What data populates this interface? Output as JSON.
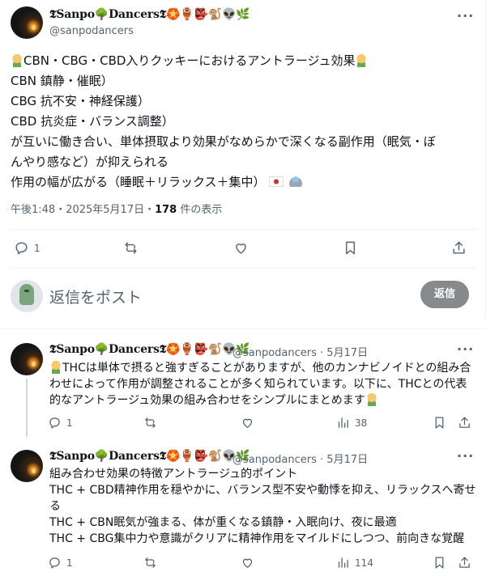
{
  "main_post": {
    "display_name": "𝕿𝐒𝐚𝐧𝐩𝐨🌳𝐃𝐚𝐧𝐜𝐞𝐫𝐬𝕿🏵️🏺👺🐒👽🌿",
    "handle": "@sanpodancers",
    "more_label": "···",
    "lines": [
      "CBN・CBG・CBD入りクッキーにおけるアントラージュ効果",
      "CBN 鎮静・催眠）",
      "CBG 抗不安・神経保護）",
      "CBD 抗炎症・バランス調整）",
      "が互いに働き合い、単体摂取より効果がなめらかで深くなる副作用（眠気・ぼ",
      "んやり感など）が抑えられる",
      "作用の幅が広がる（睡眠＋リラックス＋集中）"
    ],
    "timestamp_prefix": "午後1:48・2025年5月17日・",
    "view_count": "178",
    "view_suffix": " 件の表示",
    "reply_count": "1",
    "icons": [
      "reply-icon",
      "retweet-icon",
      "like-icon",
      "bookmark-icon",
      "share-icon"
    ]
  },
  "composer": {
    "placeholder": "返信をポスト",
    "button_label": "返信"
  },
  "replies": [
    {
      "display_name": "𝕿𝐒𝐚𝐧𝐩𝐨🌳𝐃𝐚𝐧𝐜𝐞𝐫𝐬𝕿🏵️🏺👺🐒👽🌿",
      "handle": "@sanpodancers",
      "date": "5月17日",
      "meta": "@sanpodancers · 5月17日",
      "lines": [
        "THCは単体で摂ると強すぎることがありますが、他のカンナビノイドとの組み合",
        "わせによって作用が調整されることが多く知られています。以下に、THCとの代表",
        "的なアントラージュ効果の組み合わせをシンプルにまとめます"
      ],
      "reply_count": "1",
      "view_count": "38"
    },
    {
      "display_name": "𝕿𝐒𝐚𝐧𝐩𝐨🌳𝐃𝐚𝐧𝐜𝐞𝐫𝐬𝕿🏵️🏺👺🐒👽🌿",
      "handle": "@sanpodancers",
      "date": "5月17日",
      "meta": "@sanpodancers · 5月17日",
      "lines": [
        "組み合わせ効果の特徴アントラージュ的ポイント",
        "THC + CBD精神作用を穏やかに、バランス型不安や動悸を抑え、リラックスへ寄せ",
        "る",
        "THC + CBN眠気が強まる、体が重くなる鎮静・入眠向け、夜に最適",
        "THC + CBG集中力や意識がクリアに精神作用をマイルドにしつつ、前向きな覚醒"
      ],
      "reply_count": "1",
      "view_count": "114"
    }
  ],
  "colors": {
    "text": "#0f1419",
    "secondary": "#536471",
    "divider": "#eff3f4",
    "reply_button": "#878a8d"
  }
}
